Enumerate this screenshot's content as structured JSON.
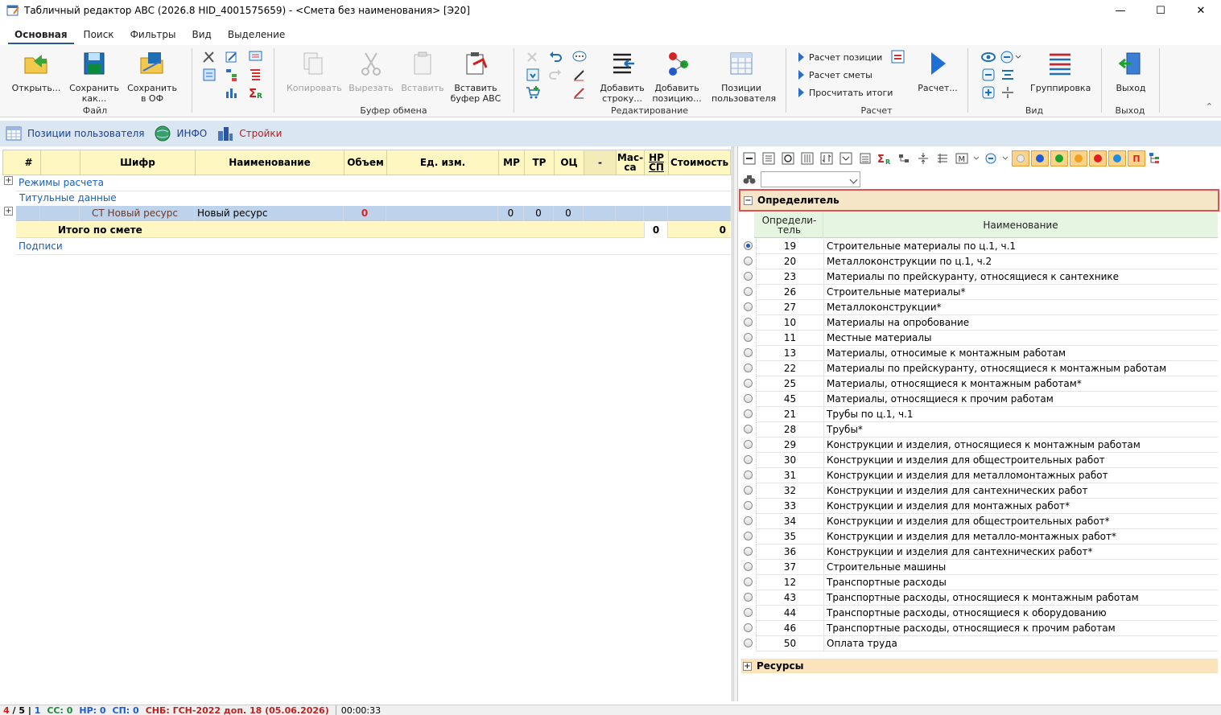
{
  "window": {
    "title": "Табличный редактор АВС (2026.8 HID_4001575659) - <Смета без наименования> [Э20]",
    "controls": [
      "minimize-icon",
      "maximize-icon",
      "close-icon"
    ]
  },
  "ribbon_tabs": [
    {
      "label": "Основная",
      "active": true
    },
    {
      "label": "Поиск"
    },
    {
      "label": "Фильтры"
    },
    {
      "label": "Вид"
    },
    {
      "label": "Выделение"
    }
  ],
  "ribbon": {
    "file": {
      "group_label": "Файл",
      "open": "Открыть...",
      "save_as": "Сохранить как...",
      "save_of": "Сохранить в ОФ"
    },
    "clipboard": {
      "group_label": "Буфер обмена",
      "copy": "Копировать",
      "cut": "Вырезать",
      "paste": "Вставить",
      "paste_abc": "Вставить буфер АВС"
    },
    "edit": {
      "group_label": "Редактирование",
      "add_row": "Добавить строку...",
      "add_position": "Добавить позицию...",
      "user_positions": "Позиции пользователя"
    },
    "calc": {
      "group_label": "Расчет",
      "calc_position": "Расчет позиции",
      "calc_estimate": "Расчет сметы",
      "recalc_totals": "Просчитать итоги",
      "calc_big": "Расчет..."
    },
    "view": {
      "group_label": "Вид",
      "grouping": "Группировка"
    },
    "exit": {
      "group_label": "Выход",
      "exit": "Выход"
    }
  },
  "quickbar": [
    {
      "label": "Позиции пользователя",
      "icon": "table-icon"
    },
    {
      "label": "ИНФО",
      "icon": "globe-icon"
    },
    {
      "label": "Стройки",
      "icon": "buildings-icon"
    }
  ],
  "grid": {
    "columns": [
      "#",
      "Шифр",
      "Наименование",
      "Объем",
      "Ед. изм.",
      "МР",
      "ТР",
      "ОЦ",
      "-",
      "Мас-са",
      "НР СП",
      "Стоимость"
    ],
    "sections": {
      "modes": "Режимы расчета",
      "title_data": "Титульные данные",
      "signatures": "Подписи"
    },
    "resource_row": {
      "code": "СТ Новый ресурс",
      "name": "Новый ресурс",
      "volume": "0",
      "mr": "0",
      "tr": "0",
      "oc": "0"
    },
    "total_row": {
      "label": "Итого по смете",
      "nr": "0",
      "cost": "0"
    }
  },
  "right_panel": {
    "filter_value": "",
    "section_title": "Определитель",
    "col_code": "Определи-тель",
    "col_name": "Наименование",
    "rows": [
      {
        "code": "19",
        "name": "Строительные материалы по ц.1, ч.1",
        "selected": true
      },
      {
        "code": "20",
        "name": "Металлоконструкции по ц.1, ч.2"
      },
      {
        "code": "23",
        "name": "Материалы по прейскуранту, относящиеся к сантехнике"
      },
      {
        "code": "26",
        "name": "Строительные материалы*"
      },
      {
        "code": "27",
        "name": "Металлоконструкции*"
      },
      {
        "code": "10",
        "name": "Материалы на опробование"
      },
      {
        "code": "11",
        "name": "Местные материалы"
      },
      {
        "code": "13",
        "name": "Материалы, относимые к монтажным работам"
      },
      {
        "code": "22",
        "name": "Материалы по прейскуранту, относящиеся к монтажным работам"
      },
      {
        "code": "25",
        "name": "Материалы, относящиеся к монтажным работам*"
      },
      {
        "code": "45",
        "name": "Материалы, относящиеся к прочим работам"
      },
      {
        "code": "21",
        "name": "Трубы по ц.1, ч.1"
      },
      {
        "code": "28",
        "name": "Трубы*"
      },
      {
        "code": "29",
        "name": "Конструкции и изделия, относящиеся к монтажным работам"
      },
      {
        "code": "30",
        "name": "Конструкции и изделия для общестроительных работ"
      },
      {
        "code": "31",
        "name": "Конструкции и изделия для металломонтажных работ"
      },
      {
        "code": "32",
        "name": "Конструкции и изделия для сантехнических работ"
      },
      {
        "code": "33",
        "name": "Конструкции и изделия для монтажных работ*"
      },
      {
        "code": "34",
        "name": "Конструкции и изделия для общестроительных работ*"
      },
      {
        "code": "35",
        "name": "Конструкции и изделия для металло-монтажных работ*"
      },
      {
        "code": "36",
        "name": "Конструкции и изделия для сантехнических работ*"
      },
      {
        "code": "37",
        "name": "Строительные машины"
      },
      {
        "code": "12",
        "name": "Транспортные расходы"
      },
      {
        "code": "43",
        "name": "Транспортные расходы, относящиеся к монтажным работам"
      },
      {
        "code": "44",
        "name": "Транспортные расходы, относящиеся к оборудованию"
      },
      {
        "code": "46",
        "name": "Транспортные расходы, относящиеся к прочим работам"
      },
      {
        "code": "50",
        "name": "Оплата труда"
      }
    ],
    "resources_title": "Ресурсы",
    "color_filters": [
      "#e8e8e8",
      "#1e5bd6",
      "#1aa32a",
      "#f0a020",
      "#e02020",
      "#1e8fe0",
      "#e02020"
    ]
  },
  "statusbar": {
    "pages_a": "4",
    "pages_b": "5",
    "pages_c": "1",
    "cc": "СС: 0",
    "nr": "НР: 0",
    "sp": "СП: 0",
    "snb": "СНБ: ГСН-2022 доп. 18 (05.06.2026)",
    "time": "00:00:33"
  },
  "colors": {
    "header_yellow": "#fff7c2",
    "selected_row": "#bdd3ec",
    "quickbar_bg": "#dbe6f3",
    "highlight_border": "#e05050"
  }
}
